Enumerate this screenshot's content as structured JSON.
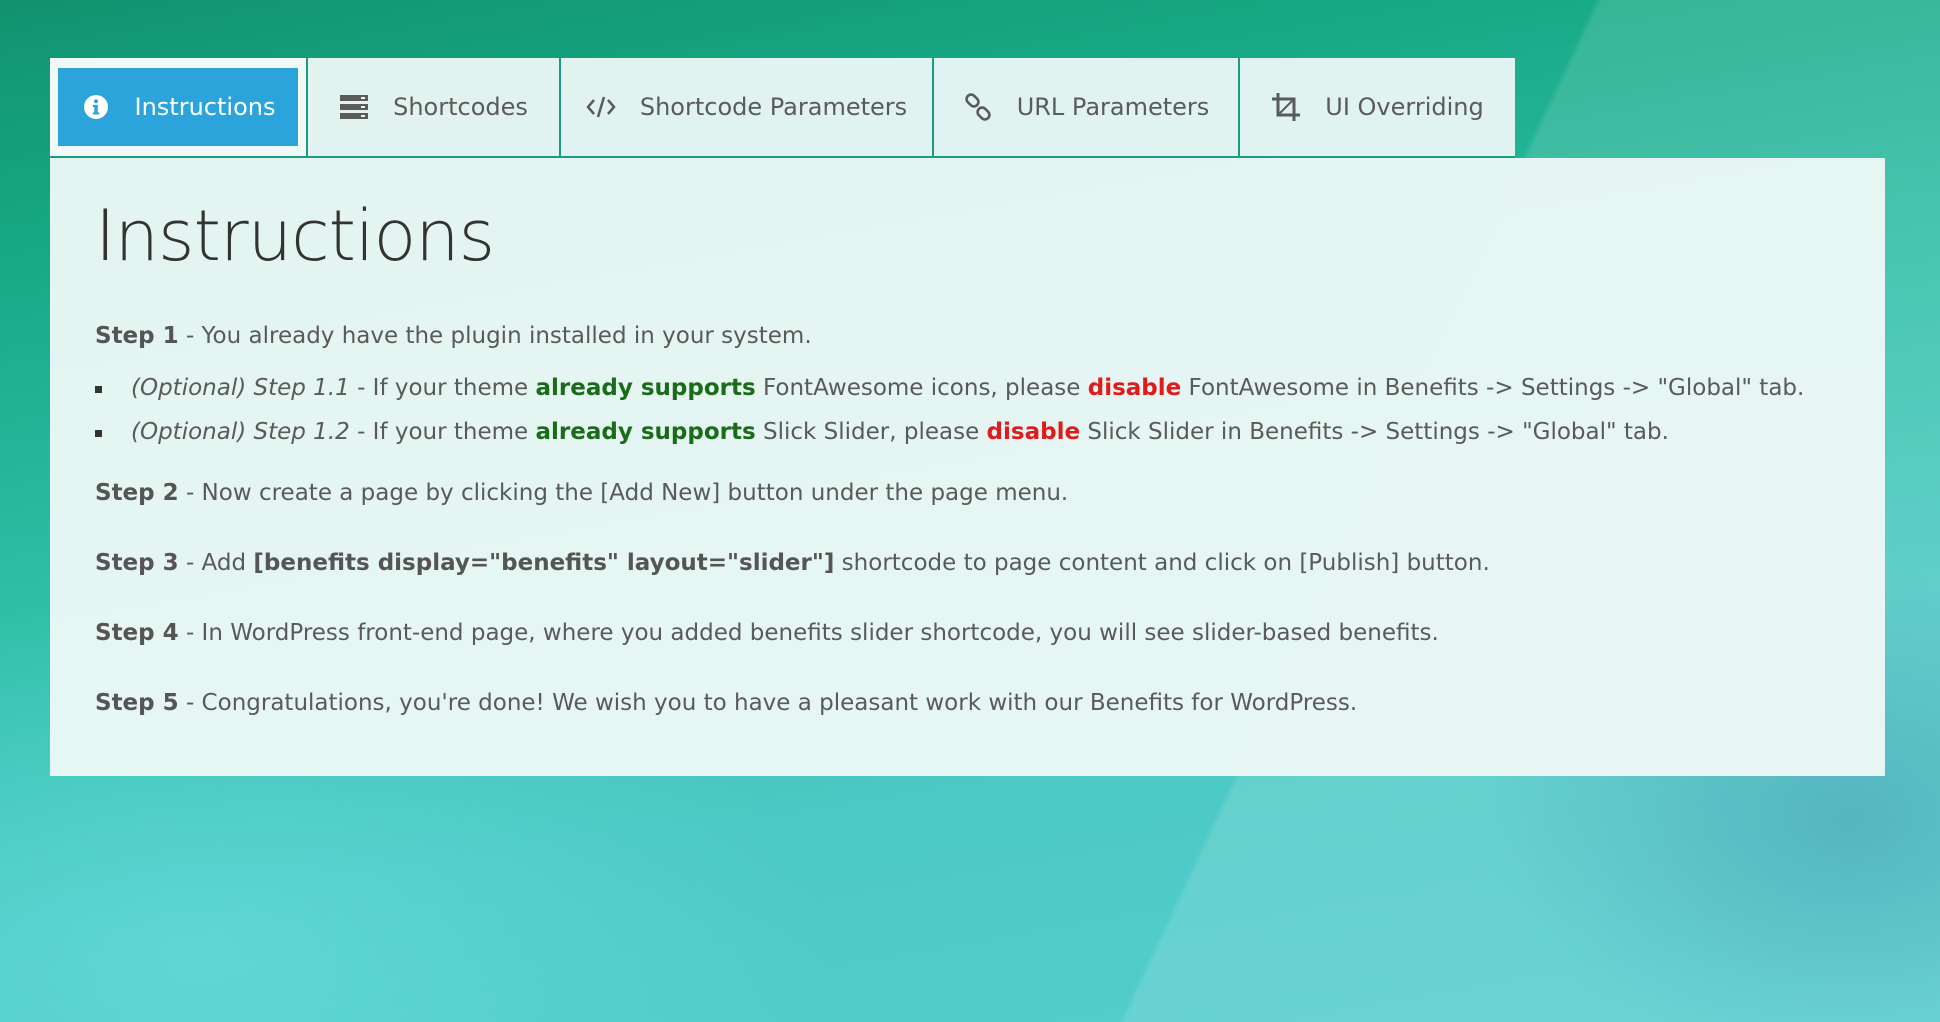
{
  "tabs": [
    {
      "label": "Instructions",
      "icon": "info-circle-icon",
      "active": true
    },
    {
      "label": "Shortcodes",
      "icon": "server-icon",
      "active": false
    },
    {
      "label": "Shortcode Parameters",
      "icon": "code-icon",
      "active": false
    },
    {
      "label": "URL Parameters",
      "icon": "link-icon",
      "active": false
    },
    {
      "label": "UI Overriding",
      "icon": "crop-icon",
      "active": false
    }
  ],
  "content": {
    "title": "Instructions",
    "step1": {
      "label": "Step 1",
      "text": " - You already have the plugin installed in your system."
    },
    "sub1": {
      "optional": "(Optional) Step 1.1",
      "t1": " - If your theme ",
      "green": "already supports",
      "t2": " FontAwesome icons, please ",
      "red": "disable",
      "t3": " FontAwesome in Benefits -> Settings -> \"Global\" tab."
    },
    "sub2": {
      "optional": "(Optional) Step 1.2",
      "t1": " - If your theme ",
      "green": "already supports",
      "t2": " Slick Slider, please ",
      "red": "disable",
      "t3": " Slick Slider in Benefits -> Settings -> \"Global\" tab."
    },
    "step2": {
      "label": "Step 2",
      "text": " - Now create a page by clicking the [Add New] button under the page menu."
    },
    "step3": {
      "label": "Step 3",
      "pre": " - Add ",
      "code": "[benefits display=\"benefits\" layout=\"slider\"]",
      "post": " shortcode to page content and click on [Publish] button."
    },
    "step4": {
      "label": "Step 4",
      "text": " - In WordPress front-end page, where you added benefits slider shortcode, you will see slider-based benefits."
    },
    "step5": {
      "label": "Step 5",
      "text": " - Congratulations, you're done! We wish you to have a pleasant work with our Benefits for WordPress."
    }
  },
  "colors": {
    "accent": "#2aa4db",
    "green": "#1a6b1a",
    "red": "#e01b1b",
    "tab_border": "#1a9c83"
  }
}
